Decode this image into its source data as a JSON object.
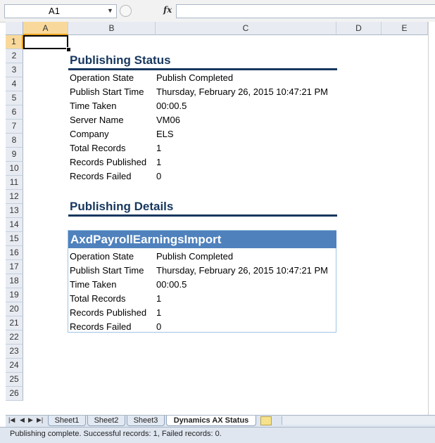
{
  "formula_bar": {
    "name_box": "A1",
    "fx_label": "fx",
    "formula": ""
  },
  "columns": [
    "A",
    "B",
    "C",
    "D",
    "E"
  ],
  "rows": [
    "1",
    "2",
    "3",
    "4",
    "5",
    "6",
    "7",
    "8",
    "9",
    "10",
    "11",
    "12",
    "13",
    "14",
    "15",
    "16",
    "17",
    "18",
    "19",
    "20",
    "21",
    "22",
    "23",
    "24",
    "25",
    "26"
  ],
  "selected_cell": "A1",
  "publishing_status": {
    "title": "Publishing Status",
    "fields": [
      {
        "label": "Operation State",
        "value": "Publish Completed"
      },
      {
        "label": "Publish Start Time",
        "value": "Thursday, February 26, 2015 10:47:21 PM"
      },
      {
        "label": "Time Taken",
        "value": "00:00.5"
      },
      {
        "label": "Server Name",
        "value": "VM06"
      },
      {
        "label": "Company",
        "value": "ELS"
      },
      {
        "label": "Total Records",
        "value": "1"
      },
      {
        "label": "Records Published",
        "value": "1"
      },
      {
        "label": "Records Failed",
        "value": "0"
      }
    ]
  },
  "publishing_details": {
    "title": "Publishing Details",
    "table_title": "AxdPayrollEarningsImport",
    "fields": [
      {
        "label": "Operation State",
        "value": "Publish Completed"
      },
      {
        "label": "Publish Start Time",
        "value": "Thursday, February 26, 2015 10:47:21 PM"
      },
      {
        "label": "Time Taken",
        "value": "00:00.5"
      },
      {
        "label": "Total Records",
        "value": "1"
      },
      {
        "label": "Records Published",
        "value": "1"
      },
      {
        "label": "Records Failed",
        "value": "0"
      }
    ]
  },
  "sheet_tabs": [
    "Sheet1",
    "Sheet2",
    "Sheet3",
    "Dynamics AX Status"
  ],
  "active_sheet": "Dynamics AX Status",
  "status_bar": {
    "text": "Publishing complete. Successful records: 1, Failed records: 0."
  },
  "colors": {
    "heading": "#17375e",
    "table_header": "#4f81bd",
    "selection": "#f9d99b"
  }
}
